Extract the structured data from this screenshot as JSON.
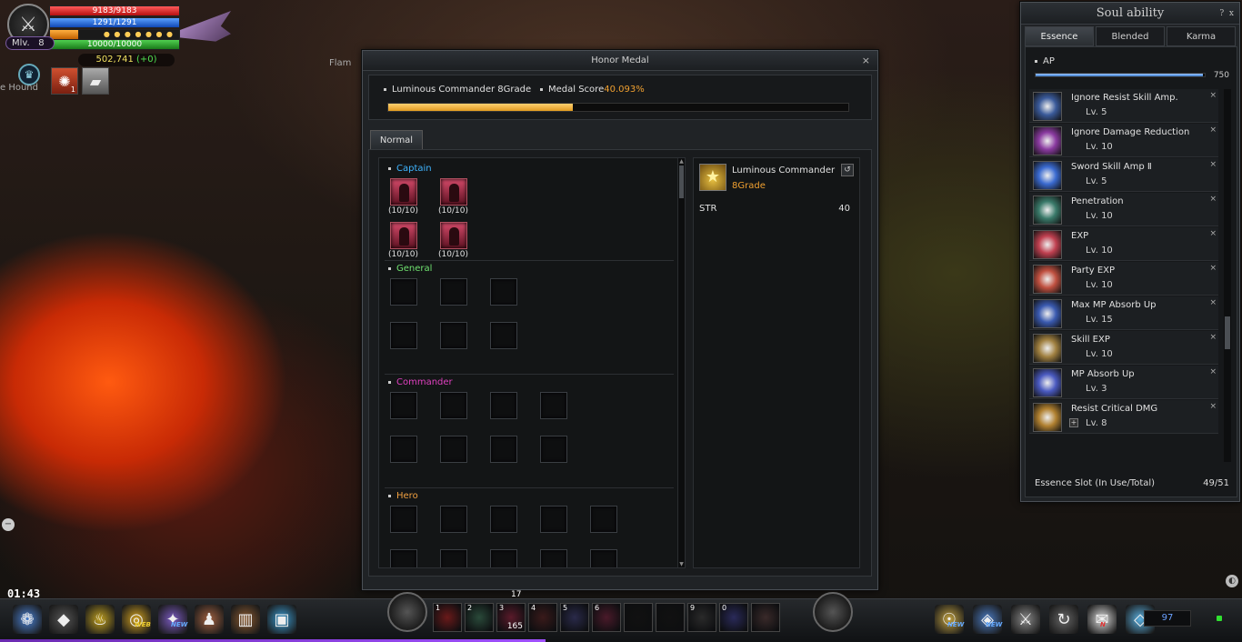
{
  "player": {
    "hp": "9183/9183",
    "mp": "1291/1291",
    "exp": "10000/10000",
    "mlv_label": "Mlv.",
    "mlv_value": "8",
    "alz": "502,741",
    "alz_delta": "(+0)",
    "sp_fraction": 0.22,
    "buff_level": "1"
  },
  "world": {
    "mob_left": "e Hound",
    "mob_right": "Flam",
    "timer": "01:43"
  },
  "honor_medal": {
    "title": "Honor Medal",
    "grade": "Luminous Commander 8Grade",
    "score_label": "Medal Score",
    "score_value": "40.093%",
    "score_fraction": 0.40093,
    "tab": "Normal",
    "sections": [
      {
        "name": "Captain",
        "color": "#3fb4ff",
        "rows": 2,
        "cols": 2,
        "filled": true,
        "captions": [
          "(10/10)",
          "(10/10)",
          "(10/10)",
          "(10/10)"
        ]
      },
      {
        "name": "General",
        "color": "#6fe06f",
        "rows": 2,
        "cols": 3,
        "filled": false
      },
      {
        "name": "Commander",
        "color": "#e040c0",
        "rows": 2,
        "cols": 4,
        "filled": false
      },
      {
        "name": "Hero",
        "color": "#f0a040",
        "rows": 2,
        "cols": 5,
        "filled": false
      }
    ],
    "detail": {
      "name": "Luminous Commander",
      "grade": "8Grade",
      "stat_name": "STR",
      "stat_value": "40"
    }
  },
  "soul_ability": {
    "title": "Soul ability",
    "help": "?",
    "close": "x",
    "tabs": [
      "Essence",
      "Blended",
      "Karma"
    ],
    "ap_label": "AP",
    "ap_value": "750",
    "ap_fraction": 0.99,
    "essences": [
      {
        "name": "Ignore Resist Skill Amp.",
        "level": "Lv. 5",
        "icon": "cross-slash-icon",
        "color": "#3a5a9a"
      },
      {
        "name": "Ignore Damage Reduction",
        "level": "Lv. 10",
        "icon": "purple-aura-icon",
        "color": "#8a3aa0"
      },
      {
        "name": "Sword Skill Amp Ⅱ",
        "level": "Lv. 5",
        "icon": "blue-sword-icon",
        "color": "#3a6ad0"
      },
      {
        "name": "Penetration",
        "level": "Lv. 10",
        "icon": "green-spiral-icon",
        "color": "#3a7a6a"
      },
      {
        "name": "EXP",
        "level": "Lv. 10",
        "icon": "red-book-icon",
        "color": "#c04050"
      },
      {
        "name": "Party EXP",
        "level": "Lv. 10",
        "icon": "red-book-arrow-icon",
        "color": "#c05040"
      },
      {
        "name": "Max MP Absorb Up",
        "level": "Lv. 15",
        "icon": "blue-burst-icon",
        "color": "#3a5ab0"
      },
      {
        "name": "Skill EXP",
        "level": "Lv. 10",
        "icon": "gold-book-icon",
        "color": "#a08040"
      },
      {
        "name": "MP Absorb Up",
        "level": "Lv. 3",
        "icon": "blue-orb-icon",
        "color": "#4a5ac0"
      },
      {
        "name": "Resist Critical DMG",
        "level": "Lv. 8",
        "icon": "gold-fist-icon",
        "color": "#b08030"
      }
    ],
    "slot_label": "Essence Slot (In Use/Total)",
    "slot_value": "49/51"
  },
  "bottom_bar": {
    "menu": [
      {
        "icon": "wings-icon",
        "glyph": "❁",
        "color": "#4a80d0"
      },
      {
        "icon": "character-icon",
        "glyph": "◆",
        "color": "#555"
      },
      {
        "icon": "lamp-icon",
        "glyph": "♨",
        "color": "#c0a020"
      },
      {
        "icon": "web-icon",
        "glyph": "◎",
        "color": "#d0a020"
      },
      {
        "icon": "gift-icon",
        "glyph": "✦",
        "color": "#7a5ac0"
      },
      {
        "icon": "mage-icon",
        "glyph": "♟",
        "color": "#a06040"
      },
      {
        "icon": "door-icon",
        "glyph": "▥",
        "color": "#8a5a30"
      },
      {
        "icon": "cube-icon",
        "glyph": "▣",
        "color": "#3a9ad0"
      }
    ],
    "menu_web": "WEB",
    "menu_new": "NEW",
    "skills": [
      {
        "key": "1",
        "count": ""
      },
      {
        "key": "2",
        "count": ""
      },
      {
        "key": "3",
        "count": "165"
      },
      {
        "key": "4",
        "count": ""
      },
      {
        "key": "5",
        "count": ""
      },
      {
        "key": "6",
        "count": ""
      },
      {
        "key": "",
        "count": ""
      },
      {
        "key": "",
        "count": ""
      },
      {
        "key": "9",
        "count": ""
      },
      {
        "key": "0",
        "count": ""
      },
      {
        "key": "",
        "count": ""
      }
    ],
    "top_count": "17",
    "right_icons": [
      {
        "icon": "guide-icon",
        "glyph": "☉",
        "color": "#c0a040"
      },
      {
        "icon": "event-icon",
        "glyph": "◈",
        "color": "#4a7ac0"
      },
      {
        "icon": "handshake-icon",
        "glyph": "⚔",
        "color": "#888"
      },
      {
        "icon": "refresh-icon",
        "glyph": "↻",
        "color": "#666"
      },
      {
        "icon": "mail-icon",
        "glyph": "✉",
        "color": "#ddd"
      },
      {
        "icon": "gem-icon",
        "glyph": "◇",
        "color": "#5ab0e0"
      }
    ],
    "right_new": "NEW",
    "mail_tag": "N",
    "gem_count": "97"
  }
}
